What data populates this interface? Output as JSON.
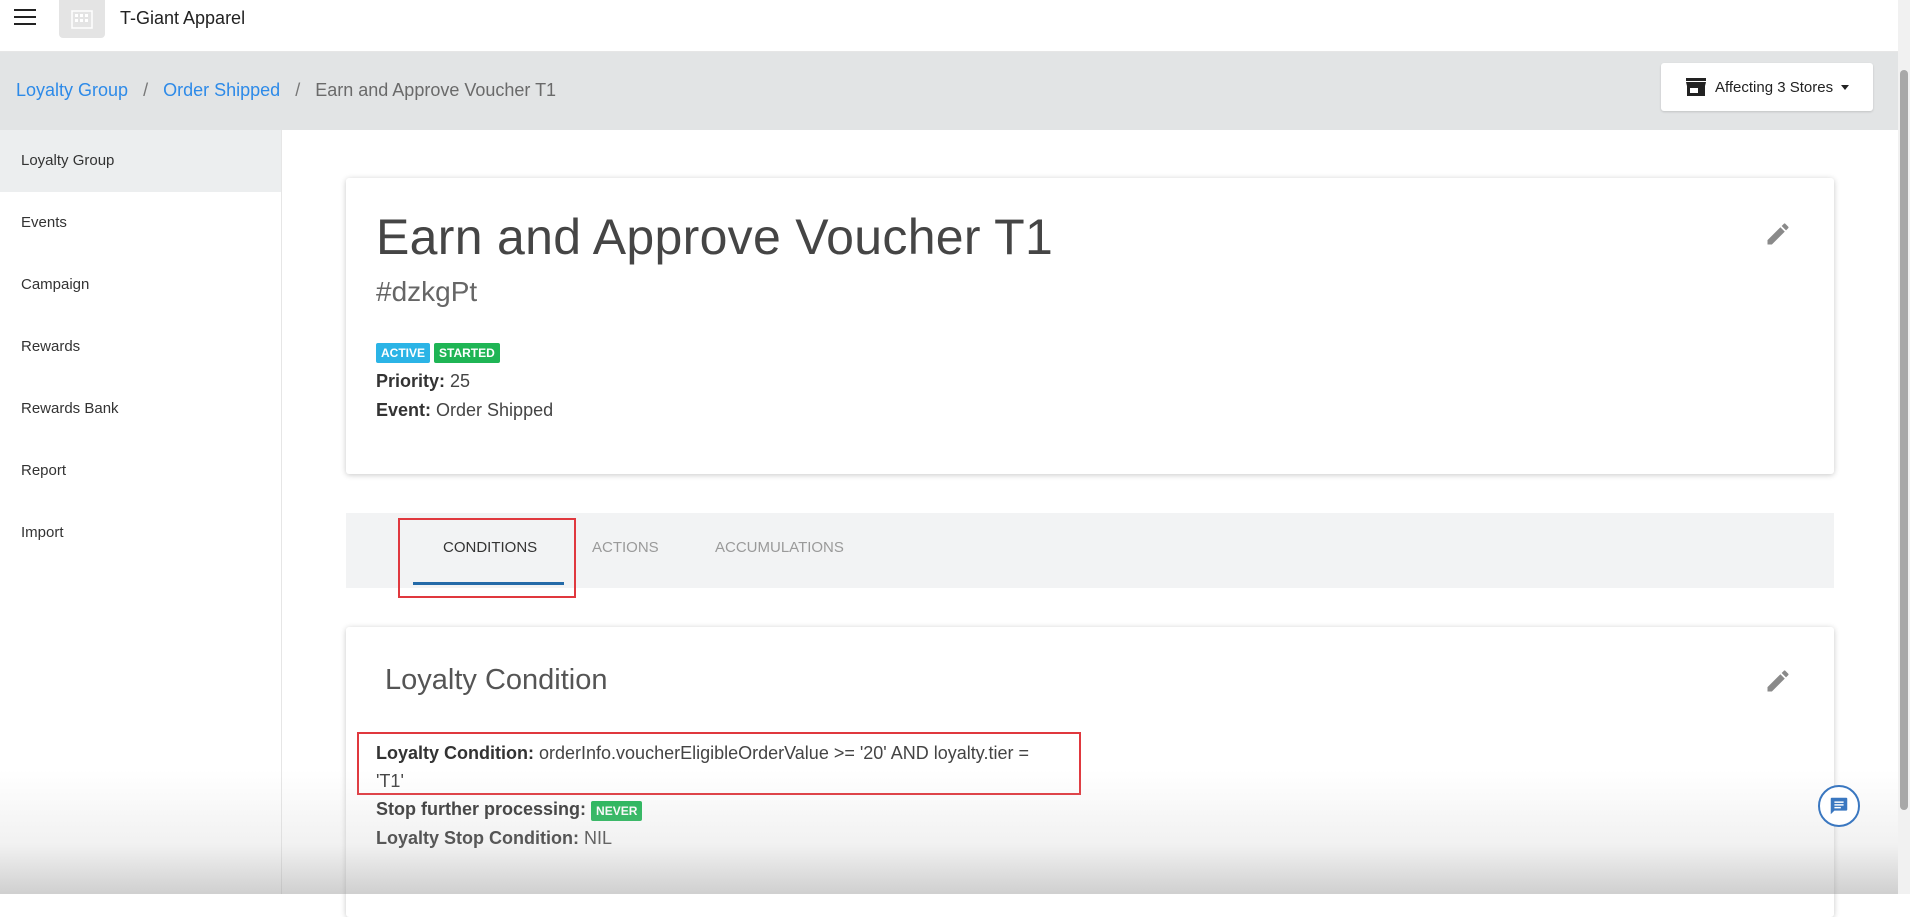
{
  "app": {
    "name": "T-Giant Apparel",
    "menu_icon": "hamburger-menu-icon",
    "logo_icon": "building-icon"
  },
  "breadcrumb": {
    "items": [
      "Loyalty Group",
      "Order Shipped"
    ],
    "separator": "/",
    "current": "Earn and Approve Voucher T1"
  },
  "stores_button": {
    "label": "Affecting 3 Stores",
    "icon": "store-icon"
  },
  "sidebar": {
    "items": [
      {
        "label": "Loyalty Group",
        "active": true
      },
      {
        "label": "Events"
      },
      {
        "label": "Campaign"
      },
      {
        "label": "Rewards"
      },
      {
        "label": "Rewards Bank"
      },
      {
        "label": "Report"
      },
      {
        "label": "Import"
      }
    ]
  },
  "rule": {
    "title": "Earn and Approve Voucher T1",
    "id": "#dzkgPt",
    "badges": [
      "ACTIVE",
      "STARTED"
    ],
    "priority_label": "Priority:",
    "priority_value": "25",
    "event_label": "Event:",
    "event_value": "Order Shipped"
  },
  "tabs": [
    {
      "label": "CONDITIONS",
      "active": true
    },
    {
      "label": "ACTIONS"
    },
    {
      "label": "ACCUMULATIONS"
    }
  ],
  "condition_card": {
    "title": "Loyalty Condition",
    "condition_label": "Loyalty Condition:",
    "condition_value_line1": "orderInfo.voucherEligibleOrderValue >= '20' AND loyalty.tier =",
    "condition_value_line2": "'T1'",
    "stop_processing_label": "Stop further processing:",
    "stop_processing_badge": "NEVER",
    "stop_condition_label": "Loyalty Stop Condition:",
    "stop_condition_value": "NIL"
  },
  "colors": {
    "link": "#2d8ae8",
    "badge_active": "#2bb4e6",
    "badge_started": "#1fb555",
    "highlight": "#e0383e",
    "tab_underline": "#246aa8"
  }
}
